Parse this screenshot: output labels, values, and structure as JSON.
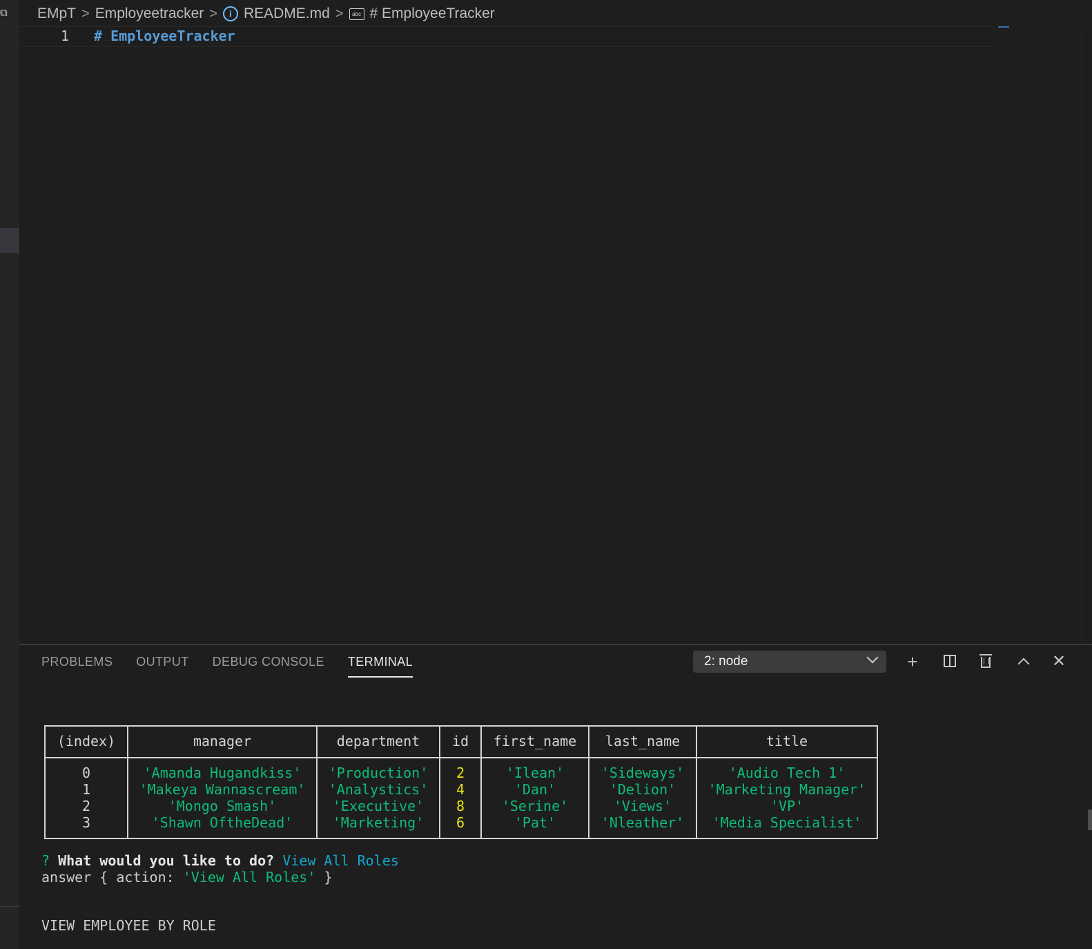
{
  "breadcrumb": {
    "root": "EMpT",
    "folder": "Employeetracker",
    "file": "README.md",
    "symbol": "# EmployeeTracker",
    "separator": ">"
  },
  "editor": {
    "line_number": "1",
    "line_text": "# EmployeeTracker"
  },
  "panel": {
    "tabs": [
      "PROBLEMS",
      "OUTPUT",
      "DEBUG CONSOLE",
      "TERMINAL"
    ],
    "active_tab": "TERMINAL",
    "terminal_select": "2: node"
  },
  "terminal": {
    "columns": [
      "(index)",
      "manager",
      "department",
      "id",
      "first_name",
      "last_name",
      "title"
    ],
    "rows": [
      [
        "0",
        "'Amanda Hugandkiss'",
        "'Production'",
        "2",
        "'Ilean'",
        "'Sideways'",
        "'Audio Tech 1'"
      ],
      [
        "1",
        "'Makeya Wannascream'",
        "'Analystics'",
        "4",
        "'Dan'",
        "'Delion'",
        "'Marketing Manager'"
      ],
      [
        "2",
        "'Mongo Smash'",
        "'Executive'",
        "8",
        "'Serine'",
        "'Views'",
        "'VP'"
      ],
      [
        "3",
        "'Shawn OftheDead'",
        "'Marketing'",
        "6",
        "'Pat'",
        "'Nleather'",
        "'Media Specialist'"
      ]
    ],
    "prompt_mark": "?",
    "prompt_question": "What would you like to do?",
    "prompt_answer": "View All Roles",
    "answer_prefix": "answer { action: ",
    "answer_value": "'View All Roles'",
    "answer_suffix": " }",
    "output_heading": "VIEW EMPLOYEE BY ROLE"
  },
  "colors": {
    "string": "#0dbc79",
    "number": "#e5e510",
    "prompt_answer": "#11a8cd",
    "heading_keyword": "#569cd6"
  }
}
